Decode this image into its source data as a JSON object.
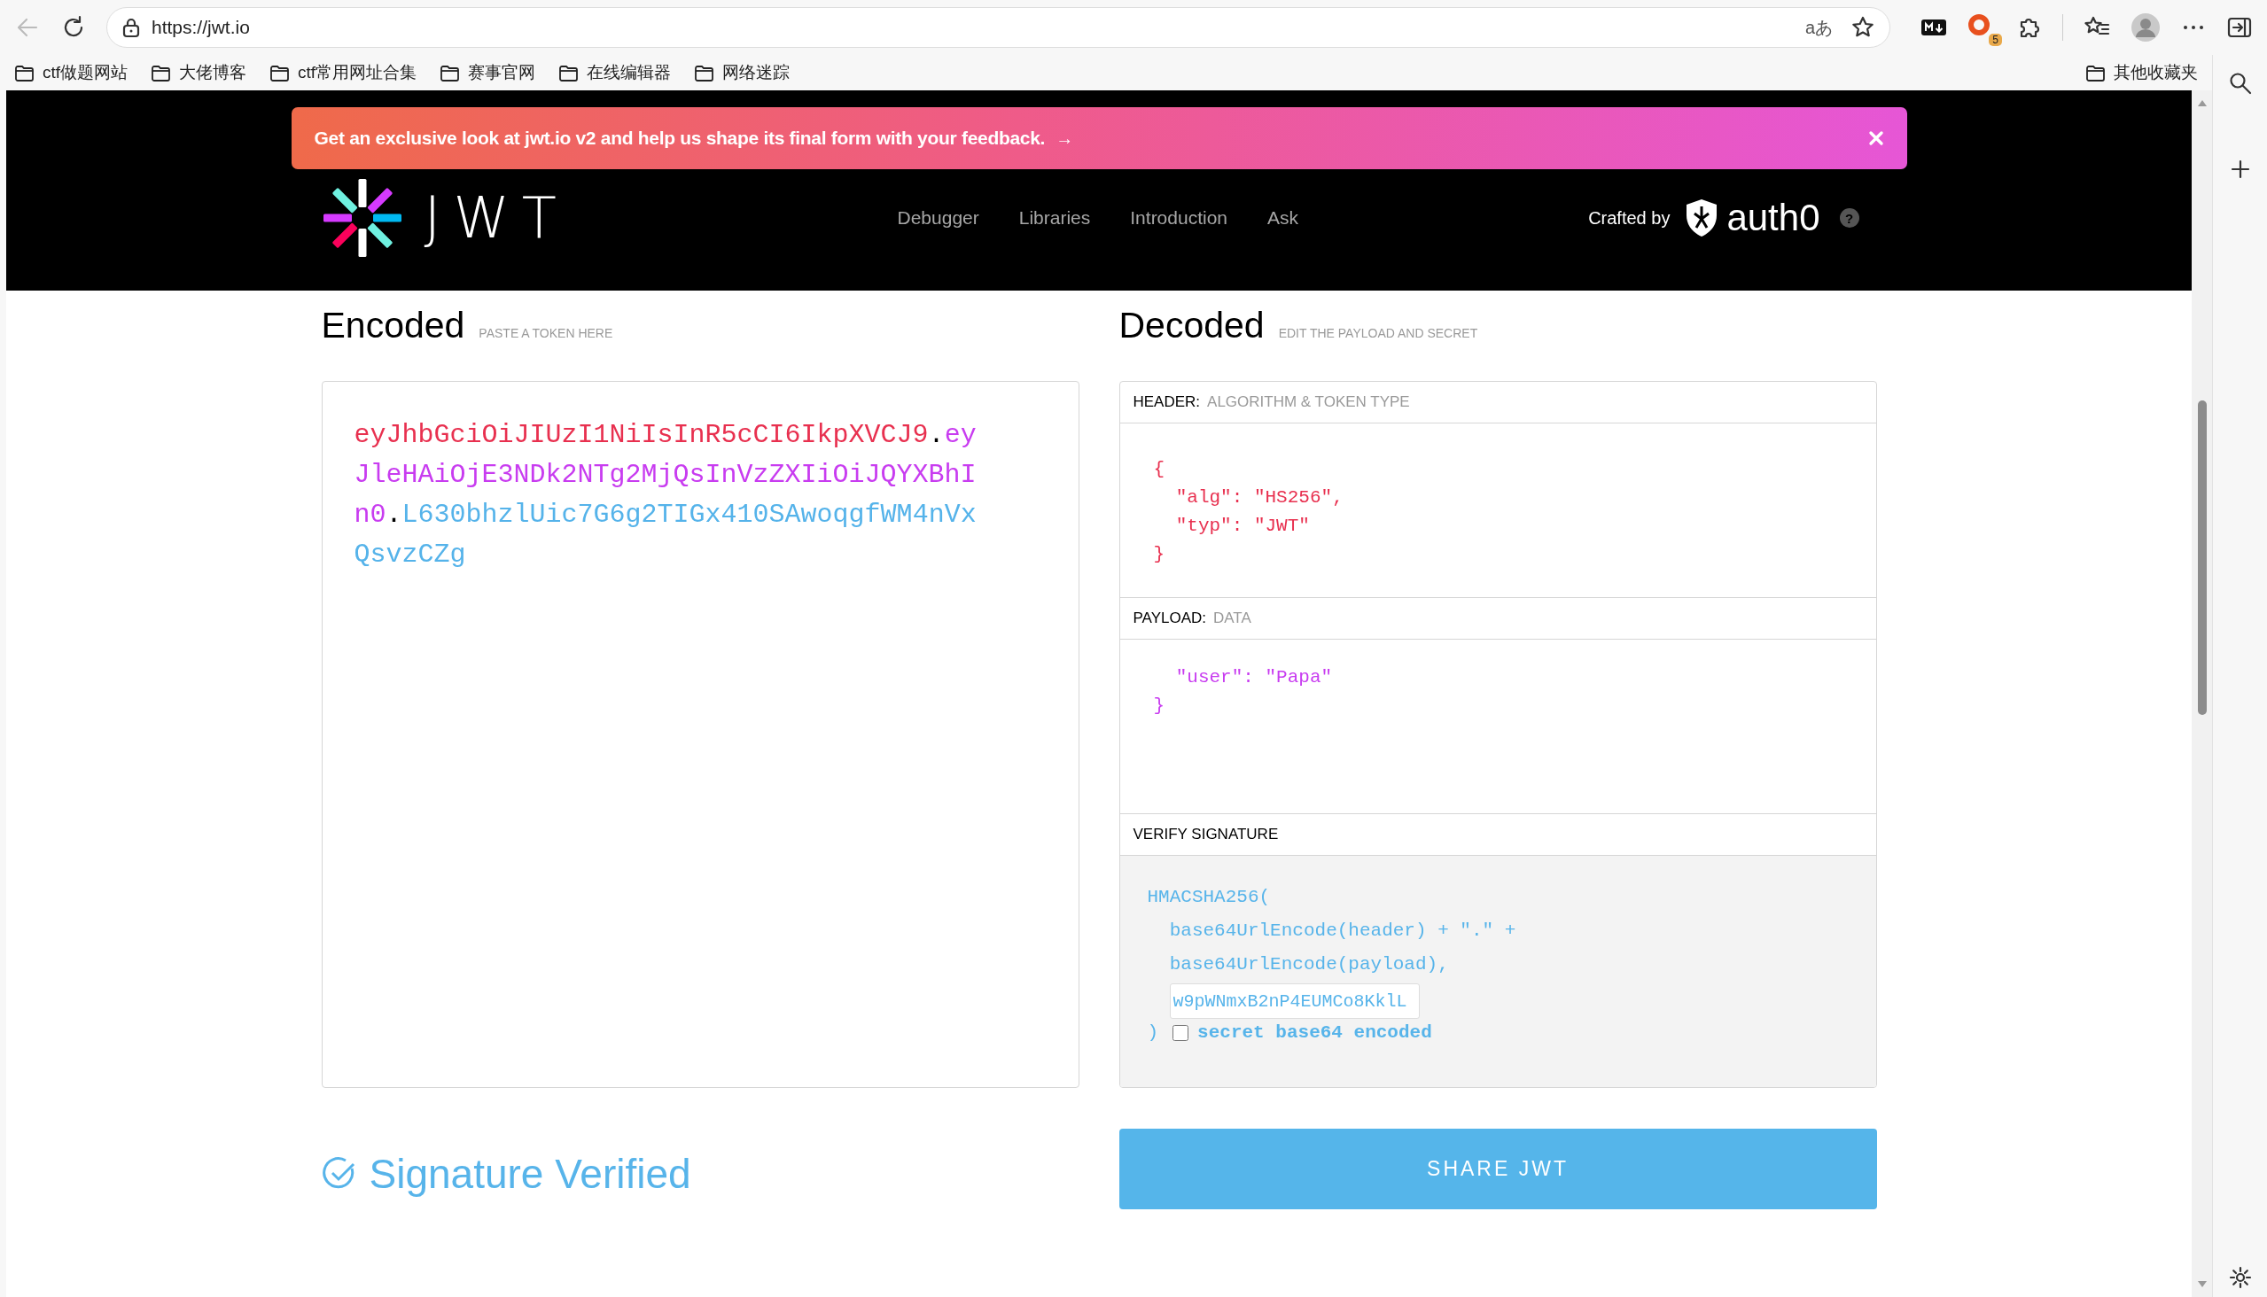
{
  "browser": {
    "url": "https://jwt.io",
    "translate_glyph": "aあ",
    "extension_badge": "5",
    "bookmarks": [
      {
        "label": "ctf做题网站"
      },
      {
        "label": "大佬博客"
      },
      {
        "label": "ctf常用网址合集"
      },
      {
        "label": "赛事官网"
      },
      {
        "label": "在线编辑器"
      },
      {
        "label": "网络迷踪"
      }
    ],
    "other_bookmarks": "其他收藏夹"
  },
  "banner": {
    "text": "Get an exclusive look at jwt.io v2 and help us shape its final form with your feedback.",
    "arrow": "→"
  },
  "nav": {
    "wordmark": "JWT",
    "items": [
      {
        "label": "Debugger"
      },
      {
        "label": "Libraries"
      },
      {
        "label": "Introduction"
      },
      {
        "label": "Ask"
      }
    ],
    "crafted_by": "Crafted by",
    "brand": "auth0",
    "help": "?"
  },
  "encoded": {
    "title": "Encoded",
    "hint": "PASTE A TOKEN HERE",
    "segments": [
      {
        "kind": "header",
        "text": "eyJhbGciOiJIUzI1NiIsInR5cCI6IkpXVCJ9"
      },
      {
        "kind": "dot",
        "text": "."
      },
      {
        "kind": "payload",
        "text": "eyJleHAiOjE3NDk2NTg2MjQsInVzZXIiOiJQYXBhIn0"
      },
      {
        "kind": "dot",
        "text": "."
      },
      {
        "kind": "signature",
        "text": "L630bhzlUic7G6g2TIGx410SAwoqgfWM4nVxQsvzCZg"
      }
    ]
  },
  "decoded": {
    "title": "Decoded",
    "hint": "EDIT THE PAYLOAD AND SECRET",
    "sections": [
      {
        "kind": "header",
        "label": "HEADER:",
        "sublabel": "ALGORITHM & TOKEN TYPE",
        "lines": [
          "{",
          "  \"alg\": \"HS256\",",
          "  \"typ\": \"JWT\"",
          "}"
        ]
      },
      {
        "kind": "payload",
        "label": "PAYLOAD:",
        "sublabel": "DATA",
        "lines": [
          "  \"user\": \"Papa\"",
          "}"
        ]
      },
      {
        "kind": "verify",
        "label": "VERIFY SIGNATURE",
        "lines": [
          "HMACSHA256(",
          "  base64UrlEncode(header) + \".\" +",
          "  base64UrlEncode(payload),"
        ],
        "secret": "w9pWNmxB2nP4EUMCo8KklL",
        "closing": ")",
        "base64_checked": false,
        "base64_label": "secret base64 encoded"
      }
    ]
  },
  "verified": "Signature Verified",
  "share_button": "SHARE JWT"
}
